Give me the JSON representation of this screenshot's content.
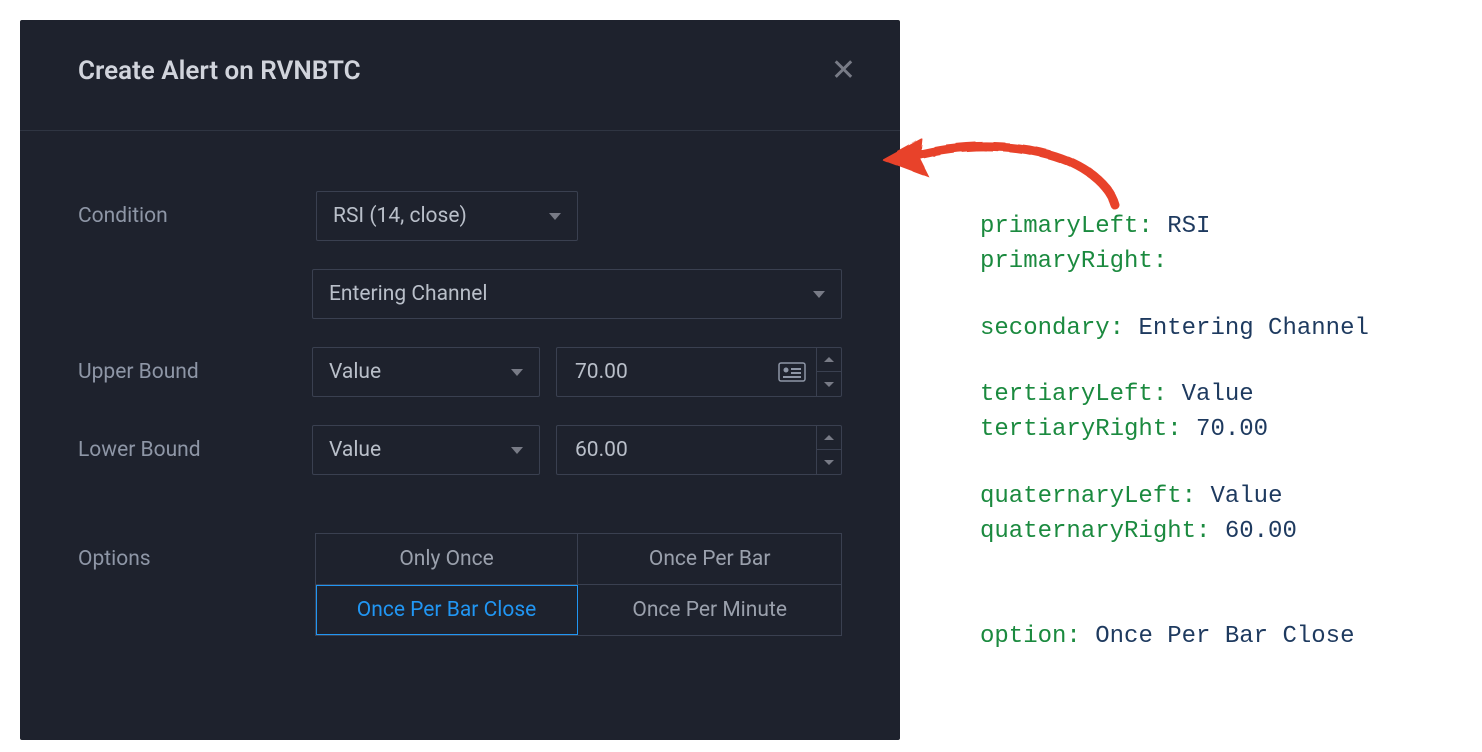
{
  "dialog": {
    "title": "Create Alert on RVNBTC",
    "condition_label": "Condition",
    "condition_primary": "RSI (14, close)",
    "condition_secondary": "Entering Channel",
    "upper_bound_label": "Upper Bound",
    "upper_bound_type": "Value",
    "upper_bound_value": "70.00",
    "lower_bound_label": "Lower Bound",
    "lower_bound_type": "Value",
    "lower_bound_value": "60.00",
    "options_label": "Options",
    "options": [
      "Only Once",
      "Once Per Bar",
      "Once Per Bar Close",
      "Once Per Minute"
    ],
    "options_selected": "Once Per Bar Close"
  },
  "annotations": {
    "primaryLeft_key": "primaryLeft:",
    "primaryLeft_val": "RSI",
    "primaryRight_key": "primaryRight:",
    "primaryRight_val": "",
    "secondary_key": "secondary:",
    "secondary_val": "Entering Channel",
    "tertiaryLeft_key": "tertiaryLeft:",
    "tertiaryLeft_val": "Value",
    "tertiaryRight_key": "tertiaryRight:",
    "tertiaryRight_val": "70.00",
    "quaternaryLeft_key": "quaternaryLeft:",
    "quaternaryLeft_val": "Value",
    "quaternaryRight_key": "quaternaryRight:",
    "quaternaryRight_val": "60.00",
    "option_key": "option:",
    "option_val": "Once Per Bar Close"
  }
}
